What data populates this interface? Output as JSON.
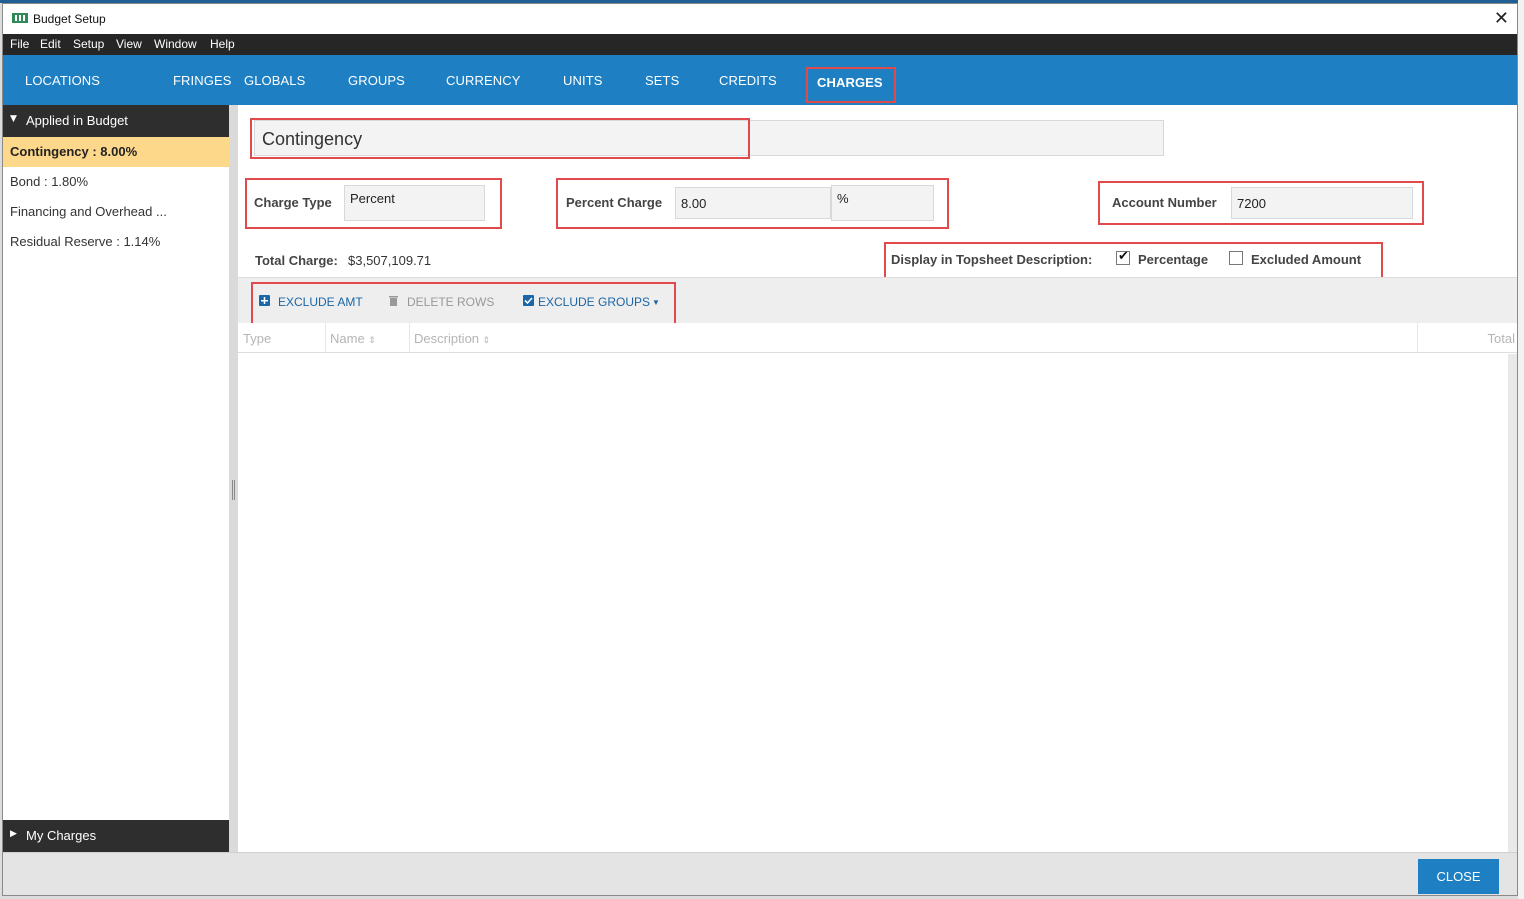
{
  "window": {
    "title": "Budget Setup"
  },
  "menu": [
    "File",
    "Edit",
    "Setup",
    "View",
    "Window",
    "Help"
  ],
  "tabs": [
    "LOCATIONS",
    "FRINGES",
    "GLOBALS",
    "GROUPS",
    "CURRENCY",
    "UNITS",
    "SETS",
    "CREDITS",
    "CHARGES"
  ],
  "active_tab": "CHARGES",
  "sidebar": {
    "applied_header": "Applied in Budget",
    "items": [
      "Contingency : 8.00%",
      "Bond : 1.80%",
      "Financing and Overhead ...",
      "Residual Reserve : 1.14%"
    ],
    "my_charges_header": "My Charges"
  },
  "charge": {
    "name": "Contingency",
    "charge_type_label": "Charge Type",
    "charge_type": "Percent",
    "percent_label": "Percent Charge",
    "percent_value": "8.00",
    "percent_unit": "%",
    "account_label": "Account Number",
    "account_value": "7200",
    "total_label": "Total Charge:",
    "total_value": "$3,507,109.71",
    "display_label": "Display in Topsheet Description:",
    "percentage_label": "Percentage",
    "percentage_checked": true,
    "excluded_label": "Excluded Amount",
    "excluded_checked": false
  },
  "toolbar": {
    "exclude_amt": "EXCLUDE AMT",
    "delete_rows": "DELETE ROWS",
    "exclude_groups": "EXCLUDE GROUPS"
  },
  "grid": {
    "columns": [
      "Type",
      "Name",
      "Description",
      "Total"
    ]
  },
  "footer": {
    "close": "CLOSE"
  },
  "colors": {
    "accent": "#1e7fc3",
    "highlight": "#e04a4a",
    "selected": "#fdd88a"
  }
}
